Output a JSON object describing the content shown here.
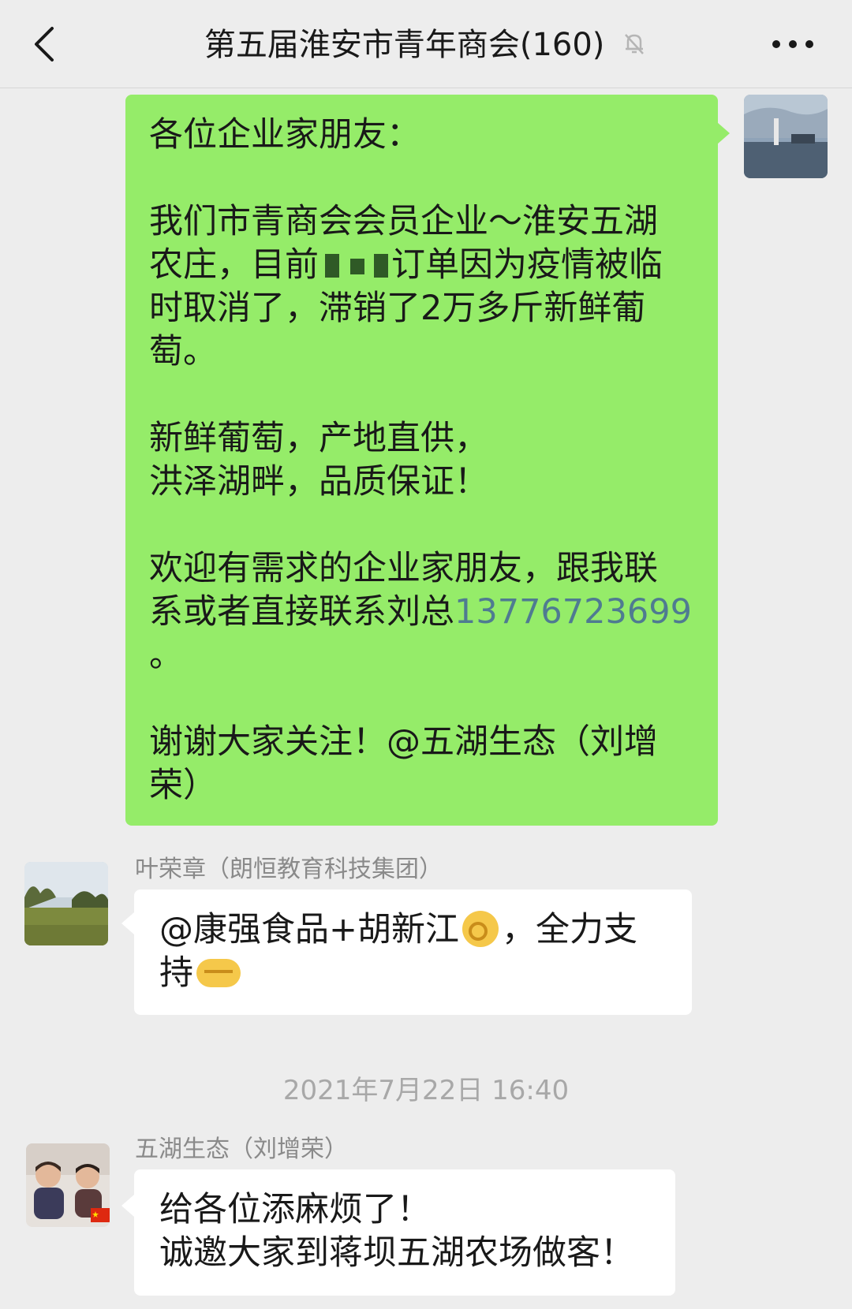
{
  "header": {
    "title": "第五届淮安市青年商会(160)",
    "back_icon": "chevron-left-icon",
    "mute_icon": "bell-muted-icon",
    "more_icon": "ellipsis-icon"
  },
  "messages": {
    "msg1": {
      "line1": "各位企业家朋友：",
      "line2": "我们市青商会会员企业～淮安五湖",
      "line3_a": "农庄，目前",
      "line3_b": "订单因为疫情被临",
      "line4": "时取消了，滞销了2万多斤新鲜葡",
      "line5": "萄。",
      "line6": "新鲜葡萄，产地直供，",
      "line7": "洪泽湖畔，品质保证！",
      "line8": "欢迎有需求的企业家朋友，跟我联",
      "line9": "系或者直接联系刘总",
      "phone": "13776723699",
      "line10": "。",
      "line11": "谢谢大家关注！@五湖生态（刘增",
      "line12": "荣）"
    },
    "msg2": {
      "sender": "叶荣章（朗恒教育科技集团）",
      "line1_a": "@康强食品+胡新江",
      "line1_b": "，全力支",
      "line2": "持"
    },
    "timestamp": "2021年7月22日 16:40",
    "msg3": {
      "sender": "五湖生态（刘增荣）",
      "line1": "给各位添麻烦了！",
      "line2": "诚邀大家到蒋坝五湖农场做客！"
    }
  },
  "colors": {
    "bubble_self": "#95ec69",
    "bubble_other": "#ffffff",
    "background": "#ededed",
    "phone_link": "#4f7b91"
  }
}
